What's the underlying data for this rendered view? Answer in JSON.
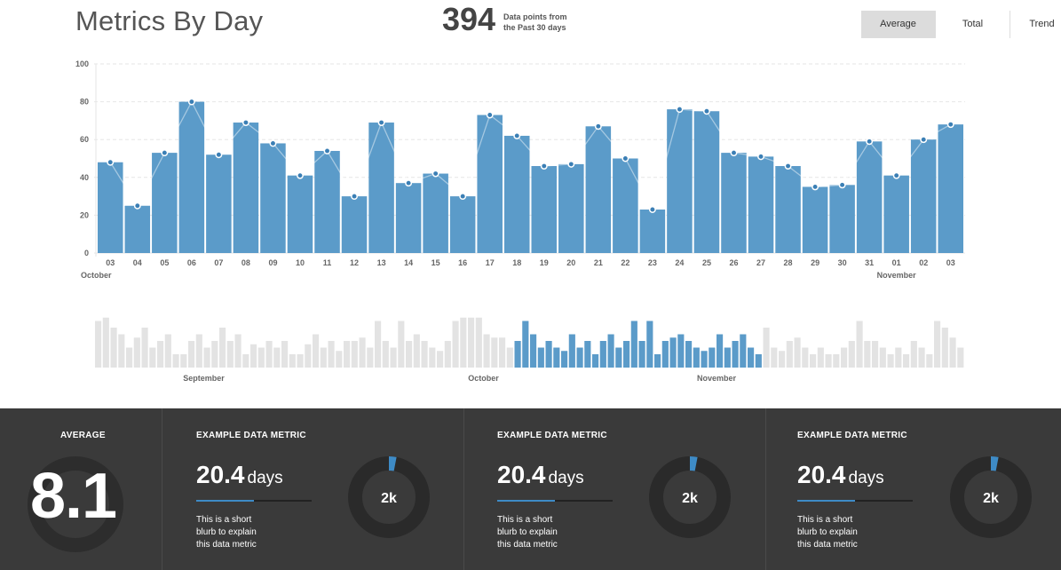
{
  "header": {
    "title": "Metrics By Day",
    "count": "394",
    "count_label_line1": "Data points from",
    "count_label_line2": "the Past 30 days",
    "toggles": [
      "Average",
      "Total",
      "Trend"
    ],
    "active_toggle": "Average"
  },
  "chart_data": [
    {
      "type": "bar",
      "categories": [
        "03",
        "04",
        "05",
        "06",
        "07",
        "08",
        "09",
        "10",
        "11",
        "12",
        "13",
        "14",
        "15",
        "16",
        "17",
        "18",
        "19",
        "20",
        "21",
        "22",
        "23",
        "24",
        "25",
        "26",
        "27",
        "28",
        "29",
        "30",
        "31",
        "01",
        "02",
        "03"
      ],
      "values": [
        48,
        25,
        53,
        80,
        52,
        69,
        58,
        41,
        54,
        30,
        69,
        37,
        42,
        30,
        73,
        62,
        46,
        47,
        67,
        50,
        23,
        76,
        75,
        53,
        51,
        46,
        35,
        36,
        59,
        41,
        60,
        68
      ],
      "series": [
        {
          "values": [
            48,
            25,
            53,
            80,
            52,
            69,
            58,
            41,
            54,
            30,
            69,
            37,
            42,
            30,
            73,
            62,
            46,
            47,
            67,
            50,
            23,
            76,
            75,
            53,
            51,
            46,
            35,
            36,
            59,
            41,
            60,
            68
          ]
        }
      ],
      "yticks": [
        "0",
        "20",
        "40",
        "60",
        "80",
        "100"
      ],
      "ylim": [
        0,
        100
      ],
      "month_labels": [
        {
          "label": "October",
          "index": 0
        },
        {
          "label": "November",
          "index": 29
        }
      ],
      "bar_color": "#5b9bc9",
      "grid": true
    },
    {
      "type": "bar",
      "values": [
        70,
        75,
        60,
        50,
        30,
        45,
        60,
        30,
        40,
        50,
        20,
        20,
        40,
        50,
        30,
        40,
        60,
        40,
        50,
        20,
        35,
        30,
        40,
        30,
        40,
        20,
        20,
        35,
        50,
        30,
        40,
        25,
        40,
        40,
        45,
        30,
        70,
        40,
        30,
        70,
        40,
        50,
        40,
        30,
        25,
        40,
        70,
        75,
        75,
        75,
        50,
        45,
        45,
        30,
        40,
        70,
        50,
        30,
        40,
        30,
        25,
        50,
        30,
        40,
        20,
        40,
        50,
        30,
        40,
        70,
        40,
        70,
        20,
        40,
        45,
        50,
        40,
        30,
        25,
        30,
        50,
        30,
        40,
        50,
        30,
        20,
        60,
        30,
        25,
        40,
        45,
        30,
        20,
        30,
        20,
        20,
        30,
        40,
        70,
        40,
        40,
        30,
        20,
        30,
        20,
        40,
        30,
        20,
        70,
        60,
        45,
        30
      ],
      "highlight_range": [
        54,
        85
      ],
      "month_labels": [
        {
          "label": "September",
          "index": 14
        },
        {
          "label": "October",
          "index": 50
        },
        {
          "label": "November",
          "index": 80
        }
      ],
      "highlight_color": "#5b9bc9",
      "base_color": "#e3e3e3"
    }
  ],
  "summary": {
    "average_label": "AVERAGE",
    "average_value": "8.1",
    "metrics": [
      {
        "label": "EXAMPLE DATA METRIC",
        "value": "20.4",
        "unit": "days",
        "blurb_line1": "This is a short",
        "blurb_line2": "blurb to explain",
        "blurb_line3": "this data metric",
        "donut_label": "2k",
        "progress": 0.03
      },
      {
        "label": "EXAMPLE DATA METRIC",
        "value": "20.4",
        "unit": "days",
        "blurb_line1": "This is a short",
        "blurb_line2": "blurb to explain",
        "blurb_line3": "this data metric",
        "donut_label": "2k",
        "progress": 0.03
      },
      {
        "label": "EXAMPLE DATA METRIC",
        "value": "20.4",
        "unit": "days",
        "blurb_line1": "This is a short",
        "blurb_line2": "blurb to explain",
        "blurb_line3": "this data metric",
        "donut_label": "2k",
        "progress": 0.03
      }
    ],
    "bar_fill": 0.5,
    "accent": "#3e8bc6"
  }
}
